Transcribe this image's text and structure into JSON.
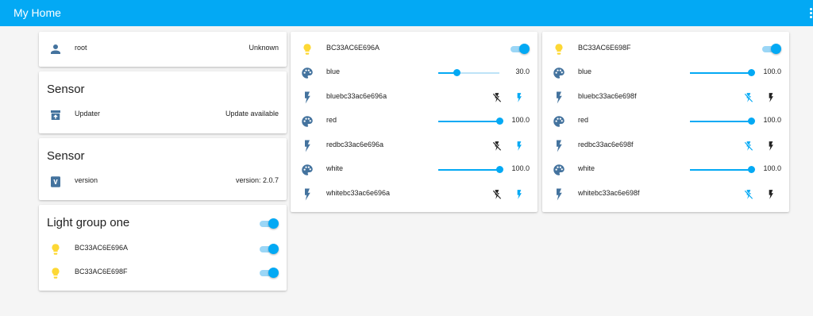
{
  "header": {
    "title": "My Home"
  },
  "left": {
    "user": {
      "name": "root",
      "state": "Unknown"
    },
    "sensor_updater": {
      "title": "Sensor",
      "name": "Updater",
      "state": "Update available"
    },
    "sensor_version": {
      "title": "Sensor",
      "name": "version",
      "state": "version: 2.0.7"
    },
    "light_group": {
      "title": "Light group one",
      "group_on": true,
      "items": [
        {
          "name": "BC33AC6E696A",
          "on": true
        },
        {
          "name": "BC33AC6E698F",
          "on": true
        }
      ]
    }
  },
  "device1": {
    "name": "BC33AC6E696A",
    "on": true,
    "rows": [
      {
        "type": "slider",
        "name": "blue",
        "value": "30.0",
        "level": 0.3
      },
      {
        "type": "buttons",
        "name": "bluebc33ac6e696a",
        "last": "on"
      },
      {
        "type": "slider",
        "name": "red",
        "value": "100.0",
        "level": 1.0
      },
      {
        "type": "buttons",
        "name": "redbc33ac6e696a",
        "last": "on"
      },
      {
        "type": "slider",
        "name": "white",
        "value": "100.0",
        "level": 1.0
      },
      {
        "type": "buttons",
        "name": "whitebc33ac6e696a",
        "last": "on"
      }
    ]
  },
  "device2": {
    "name": "BC33AC6E698F",
    "on": true,
    "rows": [
      {
        "type": "slider",
        "name": "blue",
        "value": "100.0",
        "level": 1.0
      },
      {
        "type": "buttons",
        "name": "bluebc33ac6e698f",
        "last": "off"
      },
      {
        "type": "slider",
        "name": "red",
        "value": "100.0",
        "level": 1.0
      },
      {
        "type": "buttons",
        "name": "redbc33ac6e698f",
        "last": "off"
      },
      {
        "type": "slider",
        "name": "white",
        "value": "100.0",
        "level": 1.0
      },
      {
        "type": "buttons",
        "name": "whitebc33ac6e698f",
        "last": "off"
      }
    ]
  },
  "colors": {
    "primary": "#03a9f4",
    "icon": "#44739e",
    "bulb_on": "#fdd835",
    "inactive": "#212121"
  },
  "icons": {
    "user": "account-icon",
    "updater": "package-up-icon",
    "version": "version-icon",
    "bulb": "lightbulb-icon",
    "palette": "palette-icon",
    "flash": "flash-icon",
    "flash_off": "flash-off-icon"
  }
}
